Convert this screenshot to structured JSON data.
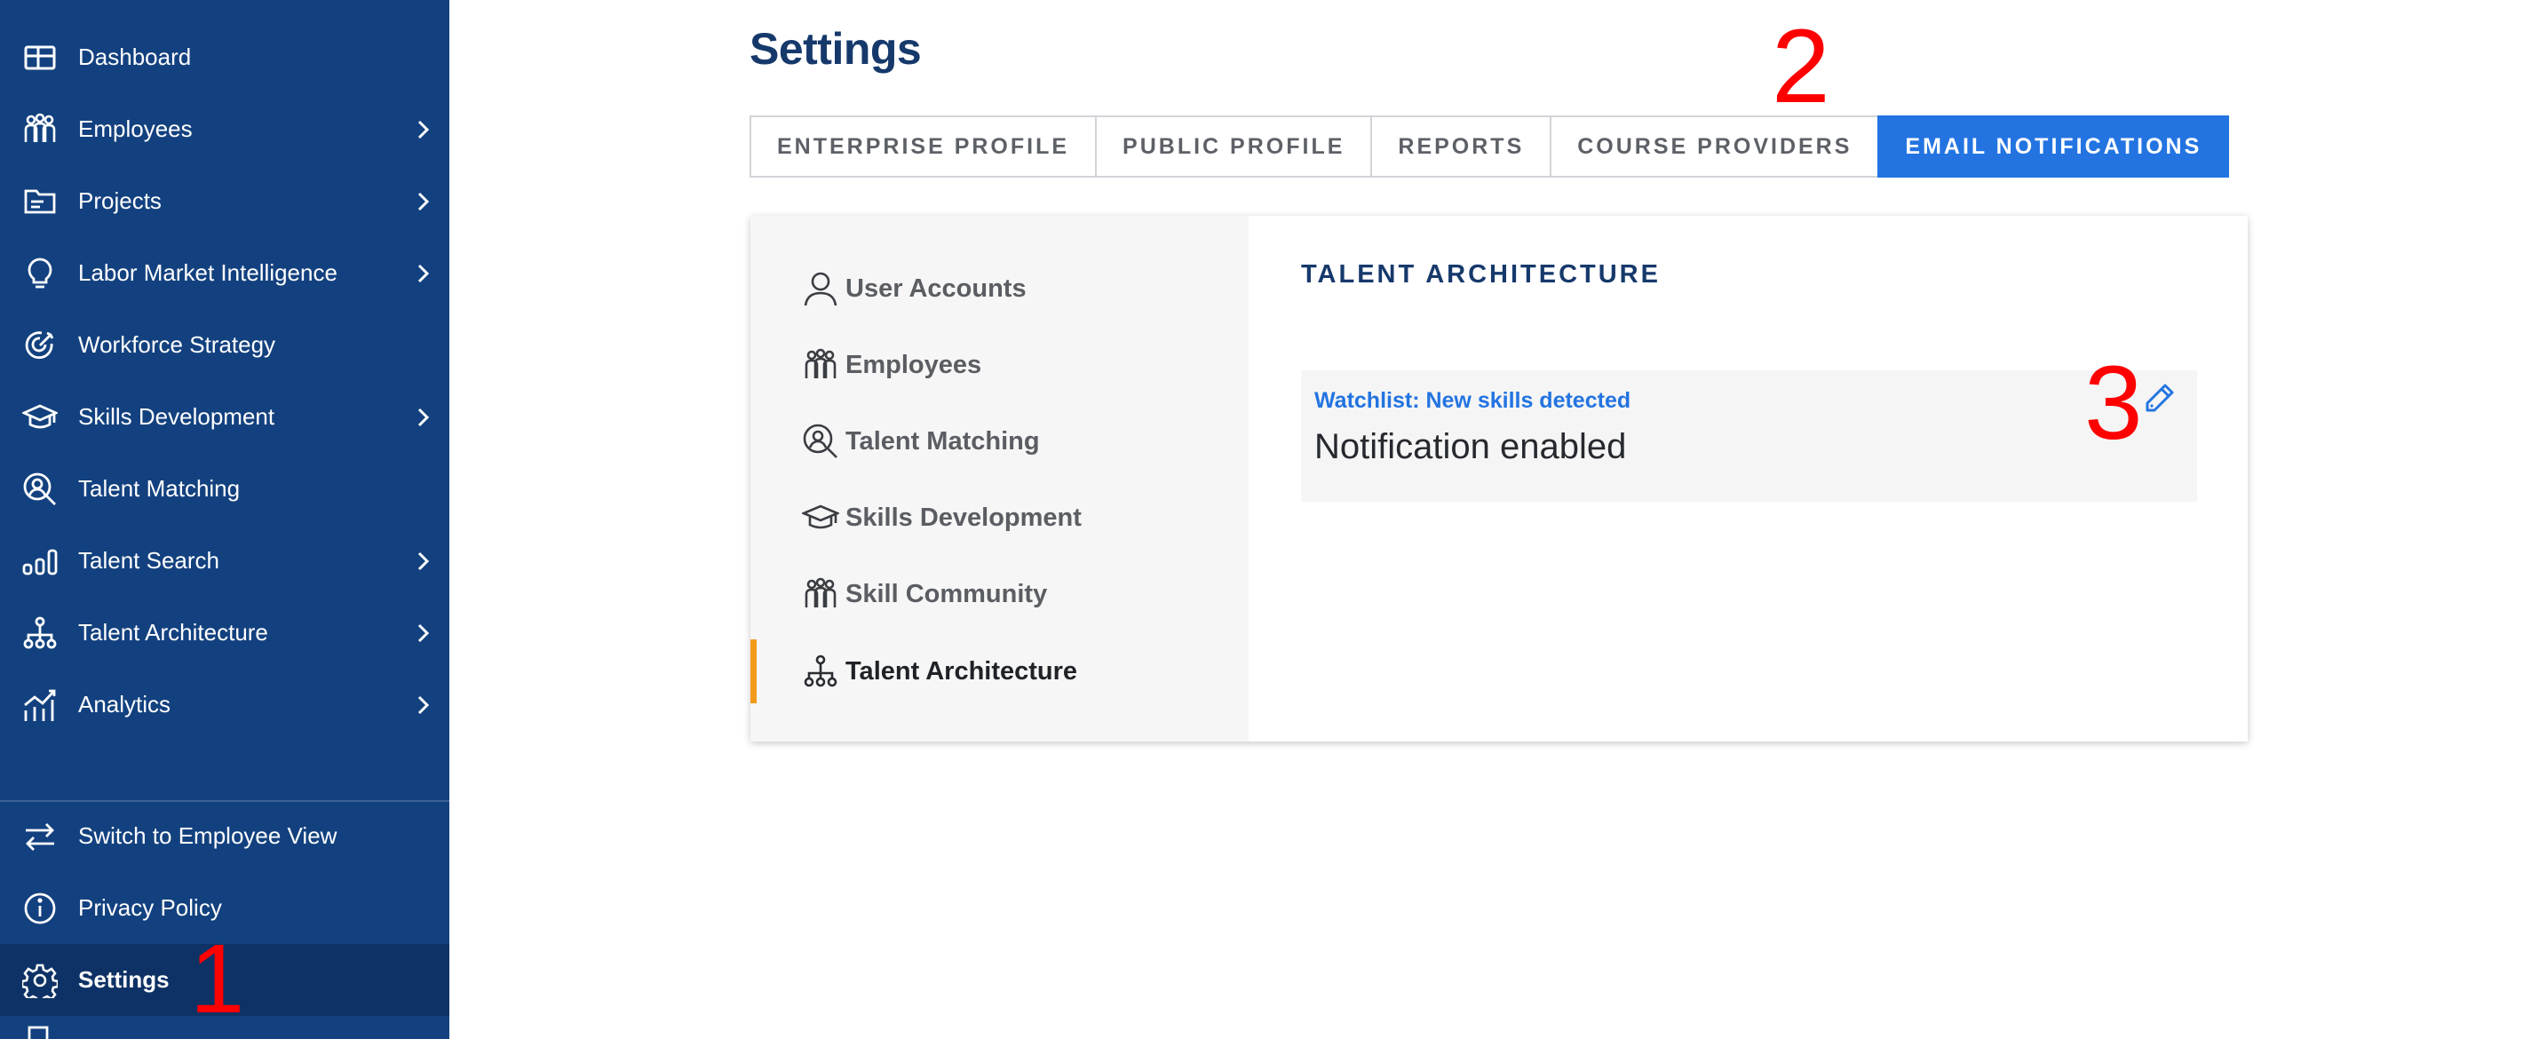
{
  "sidebar": {
    "items": [
      {
        "label": "Dashboard",
        "icon": "dashboard-icon",
        "has_submenu": false
      },
      {
        "label": "Employees",
        "icon": "people-icon",
        "has_submenu": true
      },
      {
        "label": "Projects",
        "icon": "folder-icon",
        "has_submenu": true
      },
      {
        "label": "Labor Market Intelligence",
        "icon": "lightbulb-icon",
        "has_submenu": true
      },
      {
        "label": "Workforce Strategy",
        "icon": "target-icon",
        "has_submenu": false
      },
      {
        "label": "Skills Development",
        "icon": "graduation-cap-icon",
        "has_submenu": true
      },
      {
        "label": "Talent Matching",
        "icon": "person-search-icon",
        "has_submenu": false
      },
      {
        "label": "Talent Search",
        "icon": "bar-chart-icon",
        "has_submenu": true
      },
      {
        "label": "Talent Architecture",
        "icon": "org-chart-icon",
        "has_submenu": true
      },
      {
        "label": "Analytics",
        "icon": "analytics-icon",
        "has_submenu": true
      }
    ],
    "bottom_items": [
      {
        "label": "Switch to Employee View",
        "icon": "swap-arrows-icon"
      },
      {
        "label": "Privacy Policy",
        "icon": "info-icon"
      },
      {
        "label": "Settings",
        "icon": "gear-icon",
        "active": true
      }
    ]
  },
  "annotations": {
    "one": "1",
    "two": "2",
    "three": "3",
    "color": "#ff0000"
  },
  "page": {
    "title": "Settings"
  },
  "tabs": [
    {
      "label": "ENTERPRISE PROFILE",
      "active": false
    },
    {
      "label": "PUBLIC PROFILE",
      "active": false
    },
    {
      "label": "REPORTS",
      "active": false
    },
    {
      "label": "COURSE PROVIDERS",
      "active": false
    },
    {
      "label": "EMAIL NOTIFICATIONS",
      "active": true
    }
  ],
  "subnav": {
    "items": [
      {
        "label": "User Accounts",
        "icon": "user-icon"
      },
      {
        "label": "Employees",
        "icon": "people-icon"
      },
      {
        "label": "Talent Matching",
        "icon": "person-search-icon"
      },
      {
        "label": "Skills Development",
        "icon": "graduation-cap-icon"
      },
      {
        "label": "Skill Community",
        "icon": "people-icon"
      },
      {
        "label": "Talent Architecture",
        "icon": "org-chart-icon",
        "active": true
      }
    ]
  },
  "content": {
    "section_title": "TALENT ARCHITECTURE",
    "notification": {
      "name": "Watchlist: New skills detected",
      "status": "Notification enabled",
      "edit_icon": "pencil-icon"
    }
  },
  "colors": {
    "sidebar_bg": "#13417f",
    "sidebar_active_bg": "#0e3265",
    "accent_blue": "#2374e1",
    "title_navy": "#16396b",
    "active_indicator": "#f29b1b"
  }
}
